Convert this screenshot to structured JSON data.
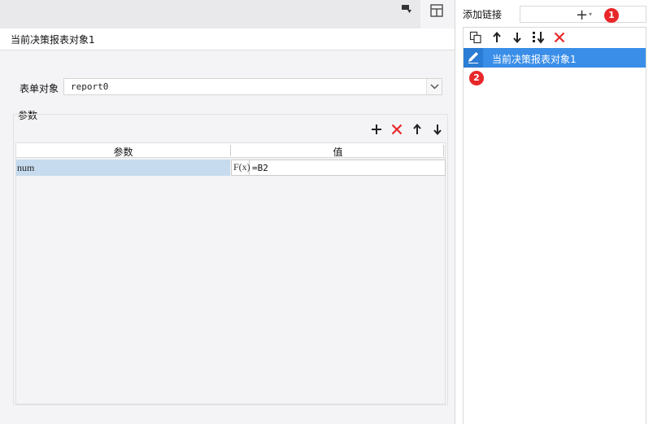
{
  "editor": {
    "title": "当前决策报表对象1",
    "form_label": "表单对象",
    "form_value": "report0",
    "params_legend": "参数",
    "grid": {
      "col_param": "参数",
      "col_value": "值",
      "rows": [
        {
          "name": "num",
          "fx": "F(x)",
          "value": "=B2"
        }
      ]
    }
  },
  "links_panel": {
    "label": "添加链接",
    "add_symbol": "+",
    "caret": "▾",
    "badges": [
      "1",
      "2"
    ],
    "items": [
      {
        "label": "当前决策报表对象1",
        "selected": true
      }
    ]
  },
  "icons": {
    "toolbar": [
      "add-icon",
      "delete-icon",
      "move-up-icon",
      "move-down-icon"
    ],
    "links_toolbar": [
      "copy-icon",
      "move-up-icon",
      "move-down-icon",
      "move-bottom-icon",
      "delete-icon"
    ]
  },
  "colors": {
    "selected_row": "#3a8ee8",
    "param_cell": "#c6dbed",
    "delete": "#e8272a",
    "badge": "#e8272a"
  }
}
